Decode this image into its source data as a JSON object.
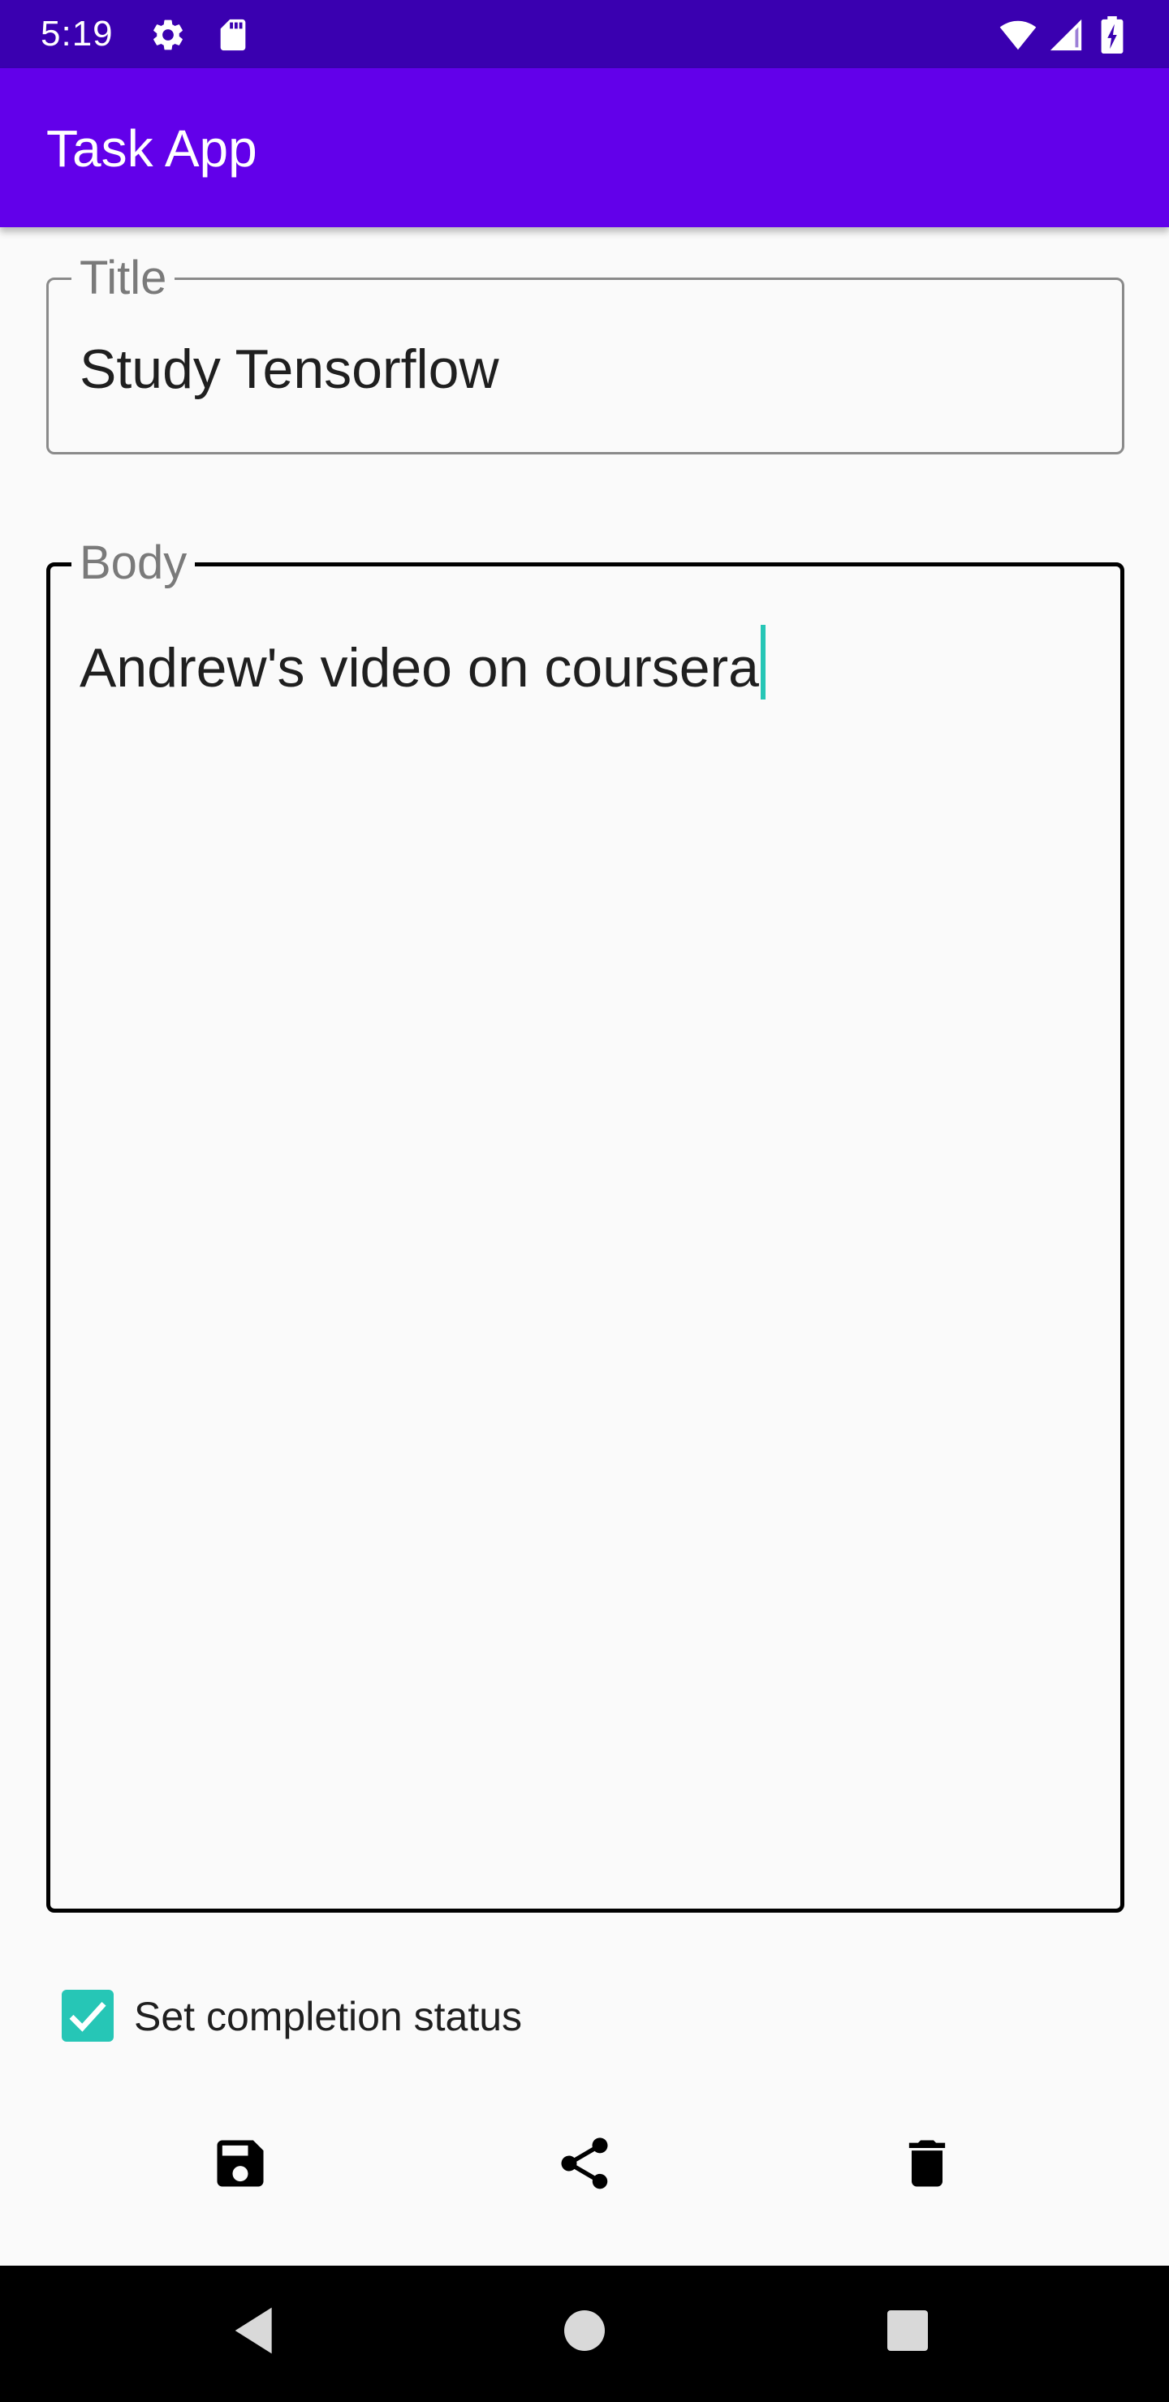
{
  "status_bar": {
    "time": "5:19",
    "icons": [
      "gear-icon",
      "sd-card-icon",
      "wifi-icon",
      "signal-icon",
      "battery-icon"
    ]
  },
  "app_bar": {
    "title": "Task App"
  },
  "form": {
    "title_field": {
      "label": "Title",
      "value": "Study Tensorflow"
    },
    "body_field": {
      "label": "Body",
      "value": "Andrew's video on coursera"
    },
    "completion": {
      "label": "Set completion status",
      "checked": true
    }
  },
  "actions": [
    "save-icon",
    "share-icon",
    "delete-icon"
  ],
  "nav_bar": [
    "back-icon",
    "home-icon",
    "recents-icon"
  ],
  "colors": {
    "status_bar": "#3a00b0",
    "app_bar": "#6200ea",
    "accent": "#26c6b6",
    "background": "#fafafa"
  }
}
